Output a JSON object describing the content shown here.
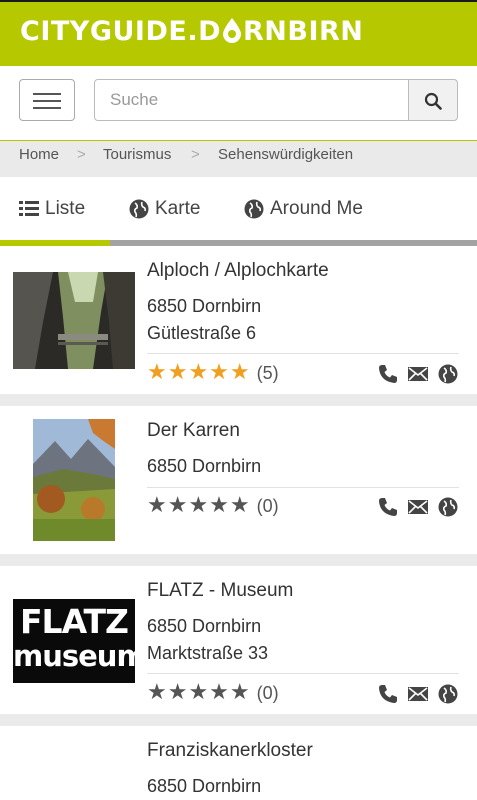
{
  "header": {
    "logo_left": "CITYGUIDE.D",
    "logo_right": "RNBIRN"
  },
  "search": {
    "placeholder": "Suche"
  },
  "breadcrumb": {
    "items": [
      "Home",
      "Tourismus",
      "Sehenswürdigkeiten"
    ],
    "separator": ">"
  },
  "tabs": [
    {
      "label": "Liste",
      "active": true
    },
    {
      "label": "Karte",
      "active": false
    },
    {
      "label": "Around Me",
      "active": false
    }
  ],
  "colors": {
    "brand": "#b5c800",
    "star_active": "#f0a020",
    "star_inactive": "#555555"
  },
  "items": [
    {
      "title": "Alploch / Alplochkarte",
      "zip_city": "6850 Dornbirn",
      "street": "Gütlestraße 6",
      "stars": "★★★★★",
      "rating": 5,
      "count": "(5)",
      "image": "gorge-photo"
    },
    {
      "title": "Der Karren",
      "zip_city": "6850 Dornbirn",
      "street": "",
      "stars": "★★★★★",
      "rating": 0,
      "count": "(0)",
      "image": "mountain-photo"
    },
    {
      "title": "FLATZ - Museum",
      "zip_city": "6850 Dornbirn",
      "street": "Marktstraße 33",
      "stars": "★★★★★",
      "rating": 0,
      "count": "(0)",
      "image": "flatz-museum-logo",
      "logo_line1": "FLATZ",
      "logo_line2": "museum"
    },
    {
      "title": "Franziskanerkloster",
      "zip_city": "6850 Dornbirn"
    }
  ]
}
